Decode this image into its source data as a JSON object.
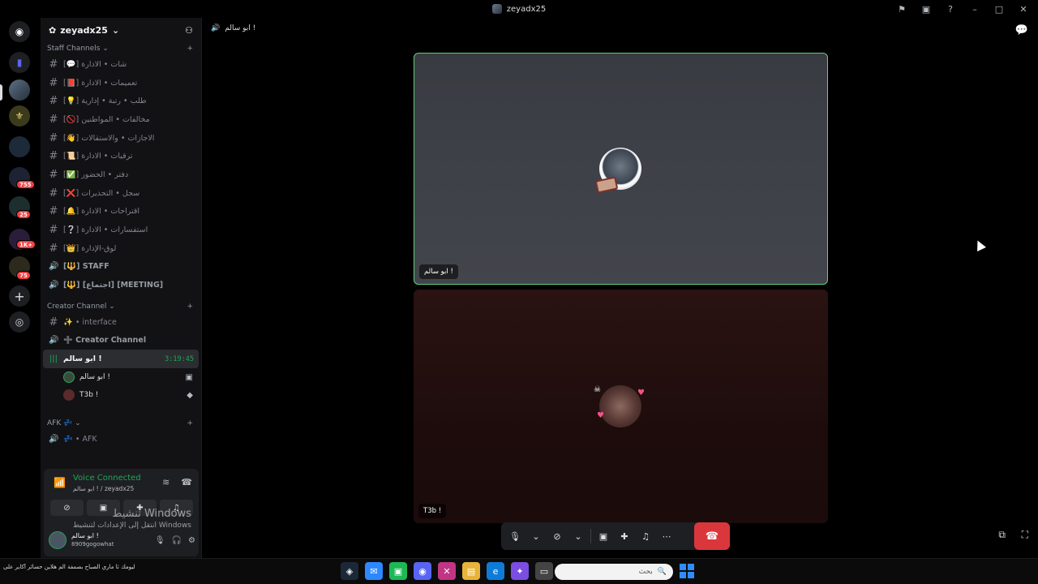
{
  "window": {
    "title": "zeyadx25"
  },
  "server": {
    "name": "zeyadx25"
  },
  "rail": {
    "badges": [
      "755",
      "25",
      "1K+",
      "75"
    ]
  },
  "categories": {
    "staff": "Staff Channels",
    "creator": "Creator Channel",
    "afk": "AFK"
  },
  "staff_channels": [
    {
      "icon": "#",
      "label": "[💬] شات • الادارة"
    },
    {
      "icon": "#",
      "label": "[📕] تعميمات • الادارة"
    },
    {
      "icon": "#",
      "label": "[💡] طلب • رتبة • إدارية"
    },
    {
      "icon": "#",
      "label": "[🚫] مخالفات • المواطنين"
    },
    {
      "icon": "#",
      "label": "[👋] الاجازات • والاستقالات"
    },
    {
      "icon": "#",
      "label": "[📜] ترقيات • الادارة"
    },
    {
      "icon": "#",
      "label": "[✅] دفتر • الحضور"
    },
    {
      "icon": "#",
      "label": "[❌] سجل • التحذيرات"
    },
    {
      "icon": "#",
      "label": "[🔔] اقتراحات • الادارة"
    },
    {
      "icon": "#",
      "label": "[❔] استفسارات • الادارة"
    },
    {
      "icon": "#",
      "label": "[👑] لوق-الإدارة"
    },
    {
      "icon": "🔊",
      "label": "[🔱] STAFF"
    },
    {
      "icon": "🔊",
      "label": "[🔱] [اجتماع] [MEETING]"
    }
  ],
  "creator_channels": [
    {
      "icon": "#",
      "label": "✨ • interface"
    },
    {
      "icon": "🔊",
      "label": "➕ Creator Channel"
    }
  ],
  "active_voice": {
    "label": "ابو سالم !",
    "timer": "3:19:45"
  },
  "voice_users": [
    {
      "name": "ابو سالم !"
    },
    {
      "name": "T3b !"
    }
  ],
  "afk_channel": {
    "label": "💤 • AFK"
  },
  "voice_panel": {
    "status": "Voice Connected",
    "sub": "ابو سالم ! / zeyadx25"
  },
  "user": {
    "display": "ابو سالم !",
    "tag": "8909gogowhat"
  },
  "watermark": {
    "line1": "تنشيط Windows",
    "line2": "انتقل إلى الإعدادات لتنشيط Windows"
  },
  "call": {
    "header": "ابو سالم !",
    "tile1_name": "ابو سالم !",
    "tile2_name": "T3b !"
  },
  "taskbar": {
    "news": "ليومك ثا ماري الصباح بصمفة الم هلاين حسائر آكاير على",
    "search_placeholder": "بحث"
  }
}
